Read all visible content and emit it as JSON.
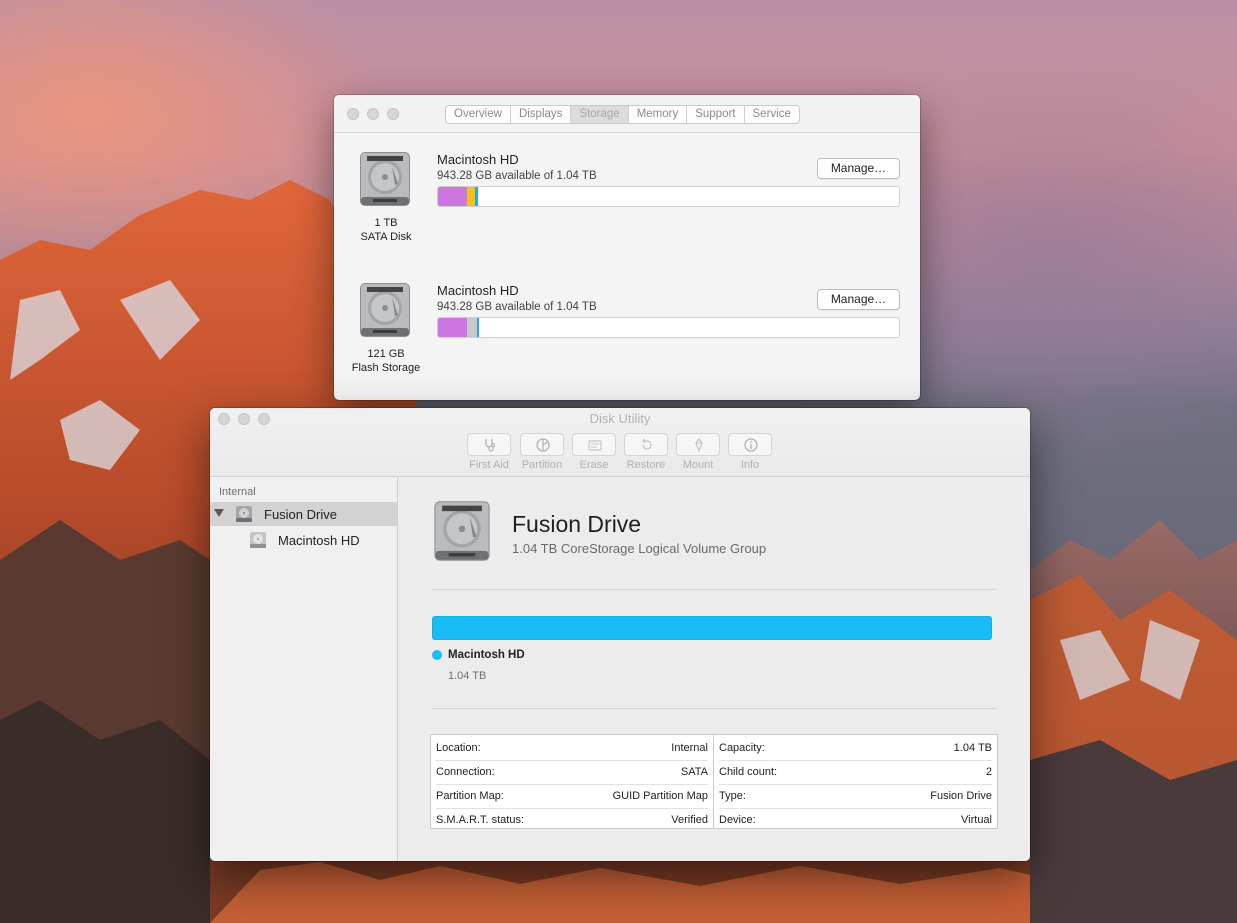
{
  "about_window": {
    "tabs": [
      "Overview",
      "Displays",
      "Storage",
      "Memory",
      "Support",
      "Service"
    ],
    "active_tab": "Storage",
    "disks": [
      {
        "volume_name": "Macintosh HD",
        "available": "943.28 GB available of 1.04 TB",
        "caption_size": "1 TB",
        "caption_type": "SATA Disk",
        "manage_label": "Manage…",
        "usage_fraction": [
          0.063,
          0.017,
          0.006
        ],
        "usage_colors": [
          "#cd75e0",
          "#f7c10f",
          "#1ea9e8"
        ]
      },
      {
        "volume_name": "Macintosh HD",
        "available": "943.28 GB available of 1.04 TB",
        "caption_size": "121 GB",
        "caption_type": "Flash Storage",
        "manage_label": "Manage…",
        "usage_fraction": [
          0.063,
          0.022,
          0.005
        ],
        "usage_colors": [
          "#cd75e0",
          "#c8c8c8",
          "#1ea9e8"
        ]
      }
    ]
  },
  "disk_utility": {
    "title": "Disk Utility",
    "toolbar": {
      "first_aid": "First Aid",
      "partition": "Partition",
      "erase": "Erase",
      "restore": "Restore",
      "mount": "Mount",
      "info": "Info"
    },
    "sidebar": {
      "section": "Internal",
      "items": [
        {
          "label": "Fusion Drive",
          "selected": true
        },
        {
          "label": "Macintosh HD",
          "selected": false
        }
      ]
    },
    "main": {
      "title": "Fusion Drive",
      "subtitle": "1.04 TB CoreStorage Logical Volume Group",
      "volume_color": "#19bdf5",
      "volume_name": "Macintosh HD",
      "volume_size": "1.04 TB"
    },
    "info": {
      "left": [
        {
          "label": "Location:",
          "value": "Internal"
        },
        {
          "label": "Connection:",
          "value": "SATA"
        },
        {
          "label": "Partition Map:",
          "value": "GUID Partition Map"
        },
        {
          "label": "S.M.A.R.T. status:",
          "value": "Verified"
        }
      ],
      "right": [
        {
          "label": "Capacity:",
          "value": "1.04 TB"
        },
        {
          "label": "Child count:",
          "value": "2"
        },
        {
          "label": "Type:",
          "value": "Fusion Drive"
        },
        {
          "label": "Device:",
          "value": "Virtual"
        }
      ]
    }
  }
}
